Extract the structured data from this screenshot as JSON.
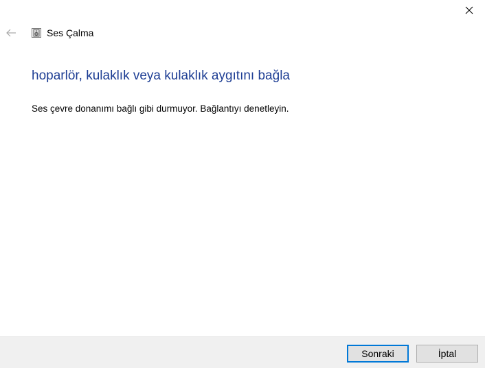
{
  "window": {
    "title": "Ses Çalma"
  },
  "content": {
    "heading": "hoparlör, kulaklık veya kulaklık aygıtını bağla",
    "message": "Ses çevre donanımı bağlı gibi durmuyor. Bağlantıyı denetleyin."
  },
  "buttons": {
    "next_label": "Sonraki",
    "cancel_label": "İptal"
  },
  "colors": {
    "heading": "#1e3e94",
    "accent": "#0078d7",
    "footer_bg": "#f0f0f0"
  },
  "icons": {
    "close": "close-icon",
    "back": "back-arrow-icon",
    "app": "speaker-icon"
  }
}
